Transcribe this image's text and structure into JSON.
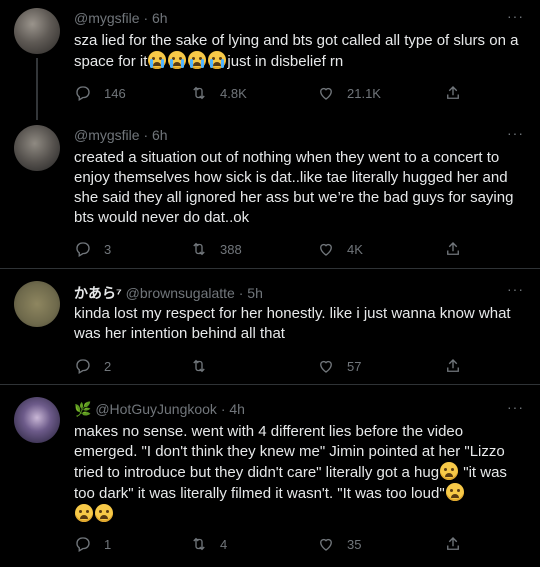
{
  "tweets": [
    {
      "handle": "@mygsfile",
      "time": "6h",
      "display_name": "",
      "text": "sza lied for the sake of lying and bts got called all type of slurs on a space for it",
      "text_after_emoji": "just in disbelief rn",
      "emoji_count": 4,
      "replies": "146",
      "retweets": "4.8K",
      "likes": "21.1K"
    },
    {
      "handle": "@mygsfile",
      "time": "6h",
      "display_name": "",
      "text": "created a situation out of nothing when they went to a concert to enjoy themselves how sick is dat..like tae literally hugged her and she said they all ignored her ass but we’re the bad guys for saying bts would never do dat..ok",
      "replies": "3",
      "retweets": "388",
      "likes": "4K"
    },
    {
      "display_name": "かあら⁷",
      "handle": "@brownsugalatte",
      "time": "5h",
      "text": "kinda lost my respect for her honestly. like i just wanna know what was her intention behind all that",
      "replies": "2",
      "retweets": "",
      "likes": "57"
    },
    {
      "display_name": "",
      "handle": "@HotGuyJungkook",
      "time": "4h",
      "text_1": "makes no sense. went with 4 different lies before the video emerged. \"I don't think they knew me\" Jimin pointed at her \"Lizzo tried to introduce but they didn't care\" literally got a hug",
      "text_2": " \"it was too dark\" it was literally filmed it wasn't. \"It was too loud\"",
      "replies": "1",
      "retweets": "4",
      "likes": "35"
    }
  ],
  "icons": {
    "reply": "reply-icon",
    "retweet": "retweet-icon",
    "like": "heart-icon",
    "share": "share-icon",
    "more": "more-icon"
  },
  "colors": {
    "background": "#000000",
    "text": "#e7e9ea",
    "muted": "#71767b",
    "divider": "#2f3336"
  },
  "more_glyph": "···",
  "separator": "·"
}
